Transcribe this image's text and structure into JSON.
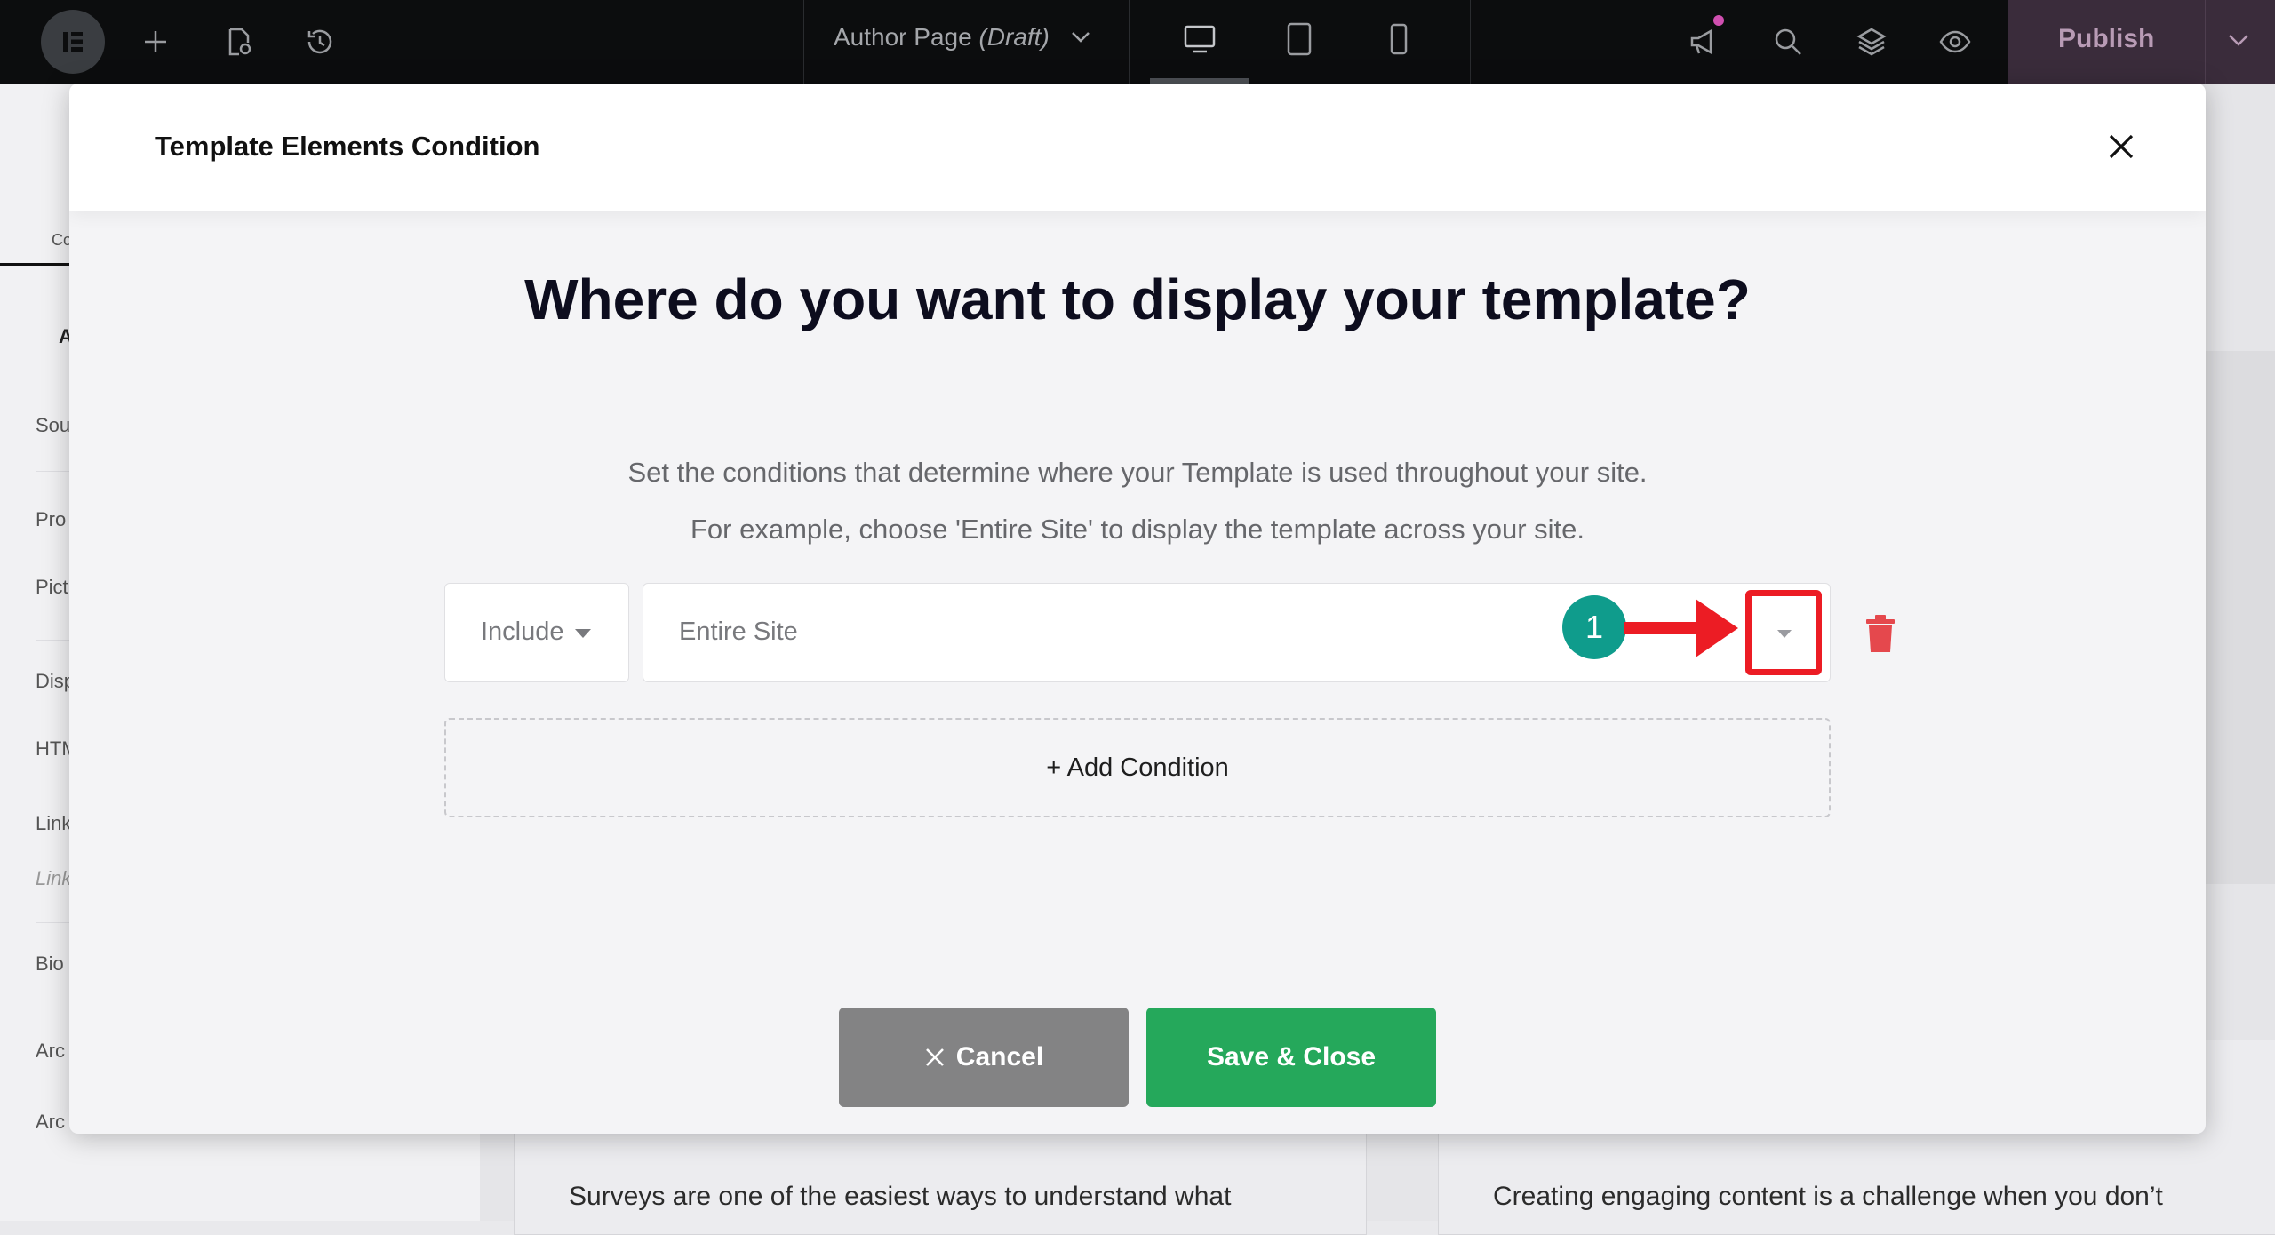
{
  "topbar": {
    "document_title": "Author Page",
    "document_status": "(Draft)",
    "publish_label": "Publish"
  },
  "left_panel": {
    "tab_label": "Co",
    "section_label": "A",
    "rows": [
      "Sou",
      "Pro",
      "Pict",
      "Disp",
      "HTM",
      "Link",
      "Link",
      "Bio",
      "Arc",
      "Arc"
    ]
  },
  "canvas": {
    "left_text": "Surveys are one of the easiest ways to understand what",
    "right_text": "Creating engaging content is a challenge when you don’t"
  },
  "modal": {
    "title": "Template Elements Condition",
    "heading": "Where do you want to display your template?",
    "subtitle_1": "Set the conditions that determine where your Template is used throughout your site.",
    "subtitle_2": "For example, choose 'Entire Site' to display the template across your site.",
    "condition": {
      "type_value": "Include",
      "target_value": "Entire Site"
    },
    "step_number": "1",
    "add_condition_label": "+ Add Condition",
    "cancel_label": "Cancel",
    "save_label": "Save & Close"
  },
  "colors": {
    "highlight": "#ec1c24",
    "step_badge": "#0f9c8c",
    "save_button": "#25a85b",
    "cancel_button": "#838384",
    "trash": "#e5484d"
  },
  "icons": [
    "elementor-logo-icon",
    "plus-icon",
    "page-settings-icon",
    "history-icon",
    "chevron-down-icon",
    "desktop-icon",
    "tablet-icon",
    "mobile-icon",
    "megaphone-icon",
    "search-icon",
    "layers-icon",
    "eye-icon",
    "close-icon",
    "trash-icon",
    "arrow-right-icon"
  ]
}
